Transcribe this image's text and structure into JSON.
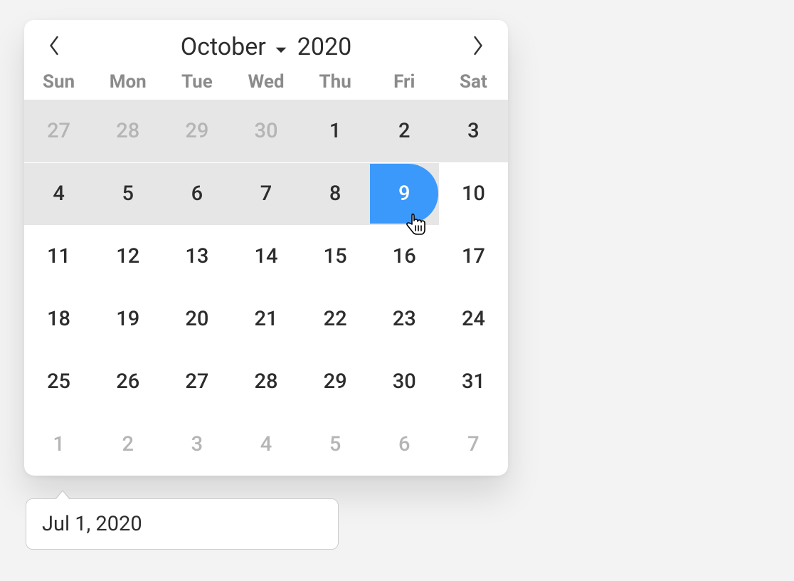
{
  "calendar": {
    "month": "October",
    "year": "2020",
    "weekdays": [
      "Sun",
      "Mon",
      "Tue",
      "Wed",
      "Thu",
      "Fri",
      "Sat"
    ],
    "rows": [
      [
        {
          "n": "27",
          "out": true
        },
        {
          "n": "28",
          "out": true
        },
        {
          "n": "29",
          "out": true
        },
        {
          "n": "30",
          "out": true
        },
        {
          "n": "1",
          "out": false
        },
        {
          "n": "2",
          "out": false
        },
        {
          "n": "3",
          "out": false
        }
      ],
      [
        {
          "n": "4",
          "out": false
        },
        {
          "n": "5",
          "out": false
        },
        {
          "n": "6",
          "out": false
        },
        {
          "n": "7",
          "out": false
        },
        {
          "n": "8",
          "out": false
        },
        {
          "n": "9",
          "out": false,
          "hovered": true
        },
        {
          "n": "10",
          "out": false
        }
      ],
      [
        {
          "n": "11",
          "out": false
        },
        {
          "n": "12",
          "out": false
        },
        {
          "n": "13",
          "out": false
        },
        {
          "n": "14",
          "out": false
        },
        {
          "n": "15",
          "out": false
        },
        {
          "n": "16",
          "out": false
        },
        {
          "n": "17",
          "out": false
        }
      ],
      [
        {
          "n": "18",
          "out": false
        },
        {
          "n": "19",
          "out": false
        },
        {
          "n": "20",
          "out": false
        },
        {
          "n": "21",
          "out": false
        },
        {
          "n": "22",
          "out": false
        },
        {
          "n": "23",
          "out": false
        },
        {
          "n": "24",
          "out": false
        }
      ],
      [
        {
          "n": "25",
          "out": false
        },
        {
          "n": "26",
          "out": false
        },
        {
          "n": "27",
          "out": false
        },
        {
          "n": "28",
          "out": false
        },
        {
          "n": "29",
          "out": false
        },
        {
          "n": "30",
          "out": false
        },
        {
          "n": "31",
          "out": false
        }
      ],
      [
        {
          "n": "1",
          "out": true
        },
        {
          "n": "2",
          "out": true
        },
        {
          "n": "3",
          "out": true
        },
        {
          "n": "4",
          "out": true
        },
        {
          "n": "5",
          "out": true
        },
        {
          "n": "6",
          "out": true
        },
        {
          "n": "7",
          "out": true
        }
      ]
    ],
    "range_highlight_rows": [
      0,
      1
    ],
    "range_end_cell": {
      "row": 1,
      "col": 5
    }
  },
  "input": {
    "value": "Jul 1, 2020"
  },
  "colors": {
    "hover": "#3b99fc"
  }
}
